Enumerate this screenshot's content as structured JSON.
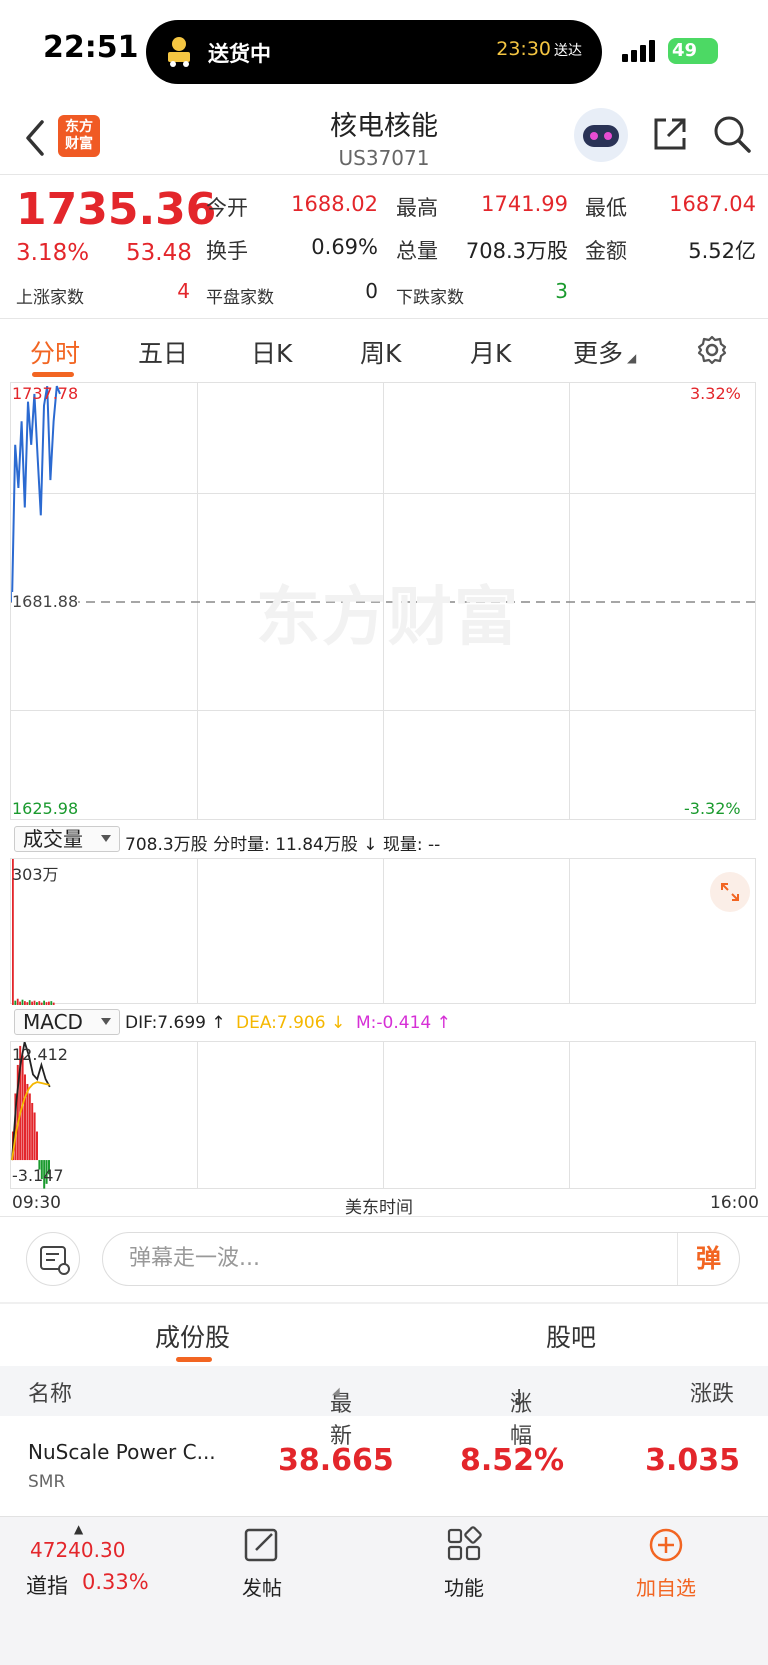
{
  "status_bar": {
    "time": "22:51",
    "activity_text": "送货中",
    "eta_time": "23:30",
    "eta_suffix": "送达",
    "battery": "49"
  },
  "header": {
    "back_icon": "chevron-left-icon",
    "logo_text": "东方财富",
    "title": "核电核能",
    "code": "US37071",
    "share_icon": "share-icon",
    "search_icon": "search-icon"
  },
  "quote": {
    "price": "1735.36",
    "change_pct": "3.18%",
    "change": "53.48",
    "fields": [
      {
        "label": "今开",
        "value": "1688.02"
      },
      {
        "label": "最高",
        "value": "1741.99"
      },
      {
        "label": "最低",
        "value": "1687.04"
      },
      {
        "label": "换手",
        "value": "0.69%"
      },
      {
        "label": "总量",
        "value": "708.3万股"
      },
      {
        "label": "金额",
        "value": "5.52亿"
      }
    ],
    "counts": [
      {
        "label": "上涨家数",
        "value": "4"
      },
      {
        "label": "平盘家数",
        "value": "0"
      },
      {
        "label": "下跌家数",
        "value": "3"
      }
    ],
    "colors": {
      "up": "#e3262b",
      "down": "#1a9a2e",
      "accent": "#f26522"
    }
  },
  "chart_tabs": [
    "分时",
    "五日",
    "日K",
    "周K",
    "月K",
    "更多"
  ],
  "chart_tabs_active": 0,
  "settings_icon": "gear-icon",
  "intraday": {
    "price_top": "1737.78",
    "pct_top": "3.32%",
    "price_mid": "1681.88",
    "price_bottom": "1625.98",
    "pct_bottom": "-3.32%",
    "watermark": "东方财富"
  },
  "volume": {
    "selector": "成交量",
    "info": "708.3万股 分时量: 11.84万股 ↓ 现量: --",
    "max_label": "303万",
    "expand_icon": "expand-icon"
  },
  "macd": {
    "selector": "MACD",
    "dif": "DIF:7.699 ↑",
    "dea": "DEA:7.906 ↓",
    "m": "M:-0.414 ↑",
    "top_label": "12.412",
    "bottom_label": "-3.147"
  },
  "time_axis": {
    "start": "09:30",
    "label": "美东时间",
    "end": "16:00"
  },
  "comment": {
    "placeholder": "弹幕走一波...",
    "danmaku_label": "弹",
    "note_icon": "note-settings-icon"
  },
  "section_tabs": [
    "成份股",
    "股吧"
  ],
  "section_active": 0,
  "columns": {
    "name": "名称",
    "latest": "最新",
    "pct": "涨幅",
    "change": "涨跌"
  },
  "constituents": [
    {
      "name": "NuScale Power C...",
      "code": "SMR",
      "latest": "38.665",
      "pct": "8.52%",
      "change": "3.035"
    }
  ],
  "bottom_bar": {
    "index_value": "47240.30",
    "index_name": "道指",
    "index_pct": "0.33%",
    "post": "发帖",
    "functions": "功能",
    "add_watch": "加自选"
  },
  "chart_data": [
    {
      "type": "line",
      "title": "",
      "xlabel": "美东时间",
      "ylabel": "",
      "xlim": [
        "09:30",
        "16:00"
      ],
      "ylim": [
        1625.98,
        1737.78
      ],
      "baseline": 1681.88,
      "series": [
        {
          "values": [
            1681.9,
            1722,
            1711,
            1728,
            1706,
            1733,
            1722,
            1735,
            1719,
            1704,
            1732,
            1737,
            1713,
            1728,
            1737,
            1735
          ]
        }
      ]
    },
    {
      "type": "bar",
      "title": "",
      "ylabel": "成交量",
      "ylim": [
        0,
        303
      ],
      "series": [
        {
          "values": [
            303,
            9,
            13,
            7,
            11,
            8,
            6,
            10,
            7,
            9,
            6,
            8,
            5,
            9,
            6,
            7,
            8,
            5
          ]
        }
      ]
    },
    {
      "type": "bar",
      "title": "",
      "ylabel": "MACD",
      "ylim": [
        -3.147,
        12.412
      ],
      "series": [
        {
          "name": "M",
          "values": [
            3,
            7,
            10,
            12,
            11,
            9,
            8,
            7,
            6,
            5,
            3,
            -1,
            -2,
            -3,
            -2.5,
            -1.5
          ]
        },
        {
          "name": "DIF",
          "values": [
            0,
            6,
            10,
            12.4,
            11,
            9,
            8.5,
            10,
            8.5,
            7.7
          ]
        },
        {
          "name": "DEA",
          "values": [
            0,
            3,
            5,
            6.5,
            7.5,
            8,
            8.2,
            8.1,
            8.0,
            7.9
          ]
        }
      ]
    }
  ]
}
